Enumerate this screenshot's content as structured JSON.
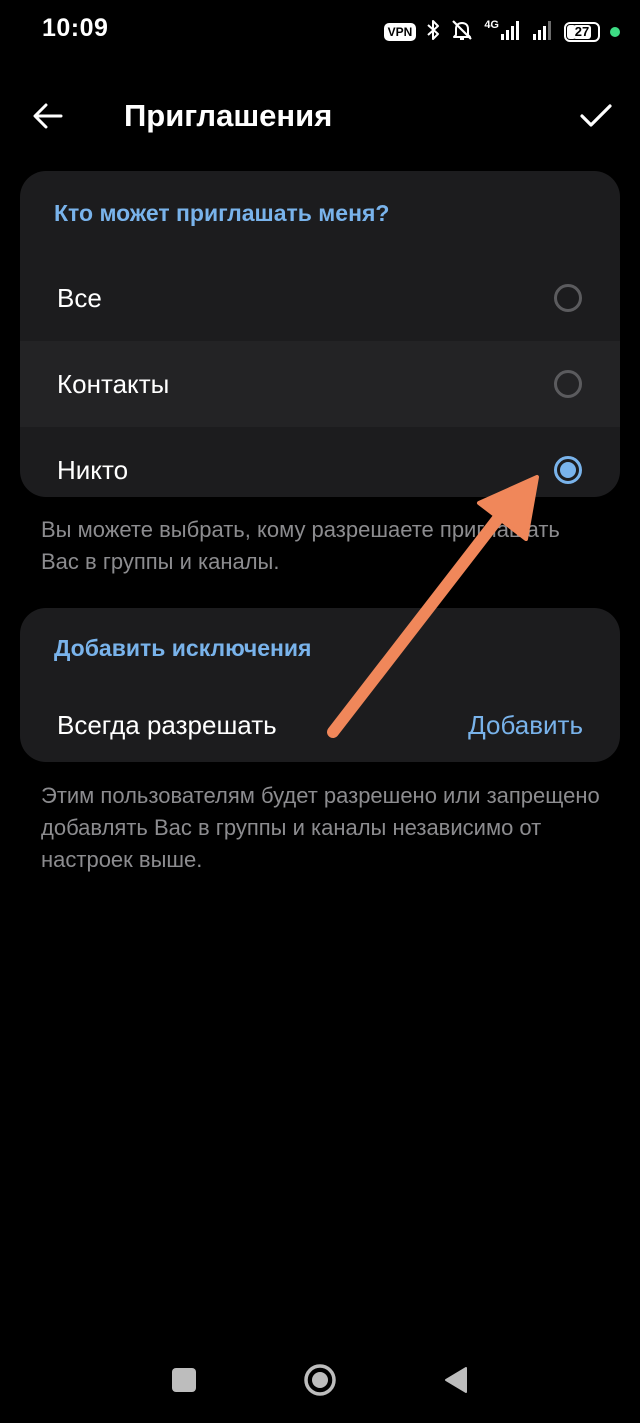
{
  "status_bar": {
    "time": "10:09",
    "vpn_label": "VPN",
    "network_type": "4G",
    "battery_level": "27",
    "icons": [
      "vpn-icon",
      "bluetooth-icon",
      "bell-muted-icon",
      "signal-icon",
      "signal-icon",
      "battery-icon"
    ]
  },
  "header": {
    "title": "Приглашения",
    "back_icon": "arrow-left-icon",
    "confirm_icon": "check-icon"
  },
  "invite_section": {
    "header": "Кто может приглашать меня?",
    "options": [
      {
        "label": "Все",
        "selected": false
      },
      {
        "label": "Контакты",
        "selected": false
      },
      {
        "label": "Никто",
        "selected": true
      }
    ],
    "hint": "Вы можете выбрать, кому разрешаете приглашать Вас в группы и каналы."
  },
  "exceptions_section": {
    "header": "Добавить исключения",
    "row_label": "Всегда разрешать",
    "add_label": "Добавить",
    "hint": "Этим пользователям будет разрешено или запрещено добавлять Вас в группы и каналы независимо от настроек выше."
  },
  "colors": {
    "background": "#000000",
    "card": "#1c1c1e",
    "accent": "#79b3eb",
    "secondary_text": "#8c8c8f",
    "annotation_arrow": "#f0875a"
  },
  "nav_bar": {
    "icons": [
      "square-icon",
      "circle-icon",
      "triangle-back-icon"
    ]
  }
}
